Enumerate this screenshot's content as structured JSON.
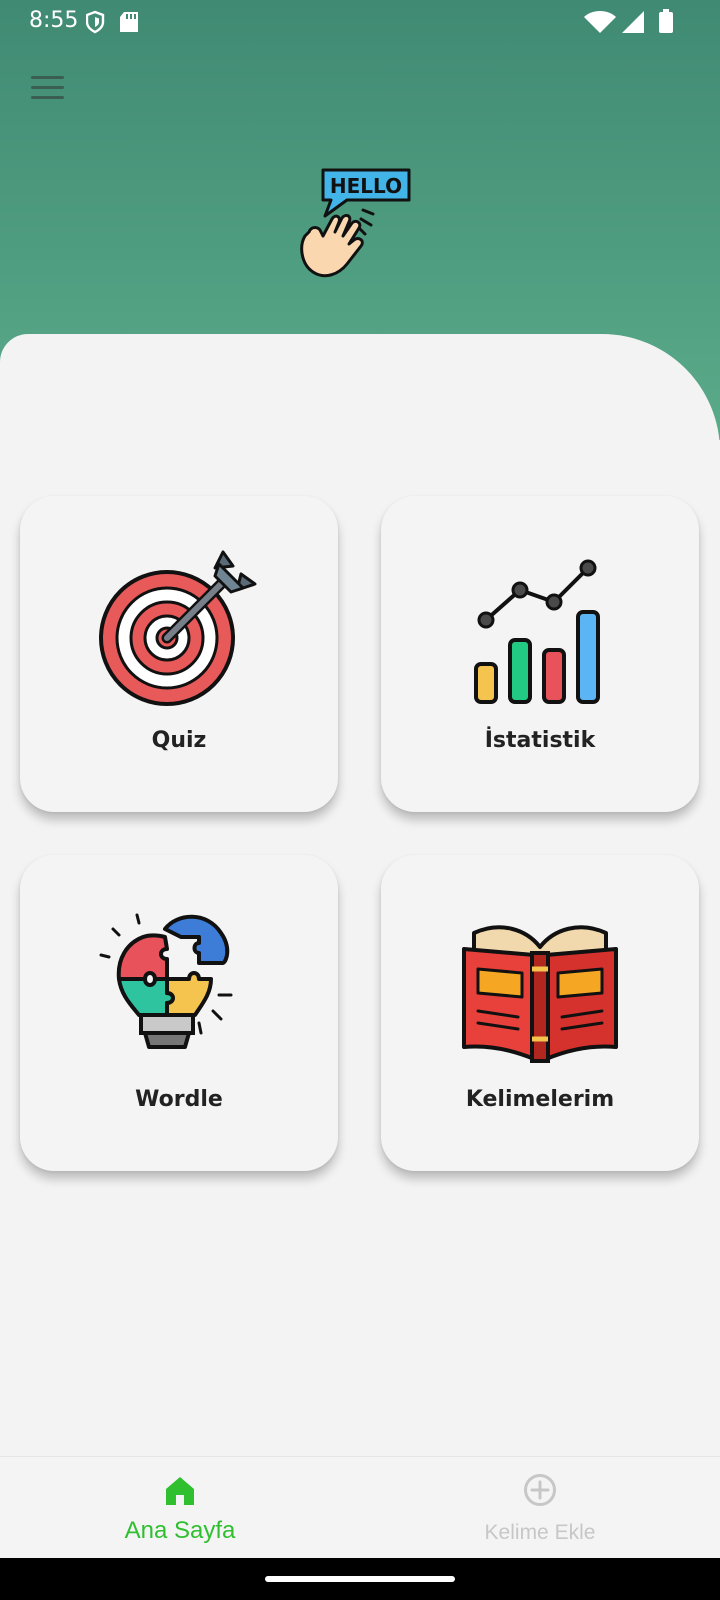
{
  "status_bar": {
    "time": "8:55",
    "left_icons": [
      "shield-icon",
      "sd-card-icon"
    ],
    "right_icons": [
      "wifi-icon",
      "signal-icon",
      "battery-icon"
    ]
  },
  "header": {
    "menu_icon": "hamburger-menu-icon",
    "illustration": {
      "icon": "hello-wave-icon",
      "text": "HELLO"
    }
  },
  "cards": [
    {
      "label": "Quiz",
      "icon": "target-dart-icon"
    },
    {
      "label": "İstatistik",
      "icon": "bar-chart-trend-icon"
    },
    {
      "label": "Wordle",
      "icon": "puzzle-lightbulb-icon"
    },
    {
      "label": "Kelimelerim",
      "icon": "open-book-icon"
    }
  ],
  "bottom_nav": {
    "items": [
      {
        "label": "Ana Sayfa",
        "icon": "home-icon",
        "active": true
      },
      {
        "label": "Kelime Ekle",
        "icon": "add-circle-icon",
        "active": false
      }
    ]
  },
  "colors": {
    "header_top": "#408a73",
    "header_bottom": "#5aab8a",
    "active_nav": "#2fbf2f",
    "inactive_nav": "#c7c7c7"
  }
}
